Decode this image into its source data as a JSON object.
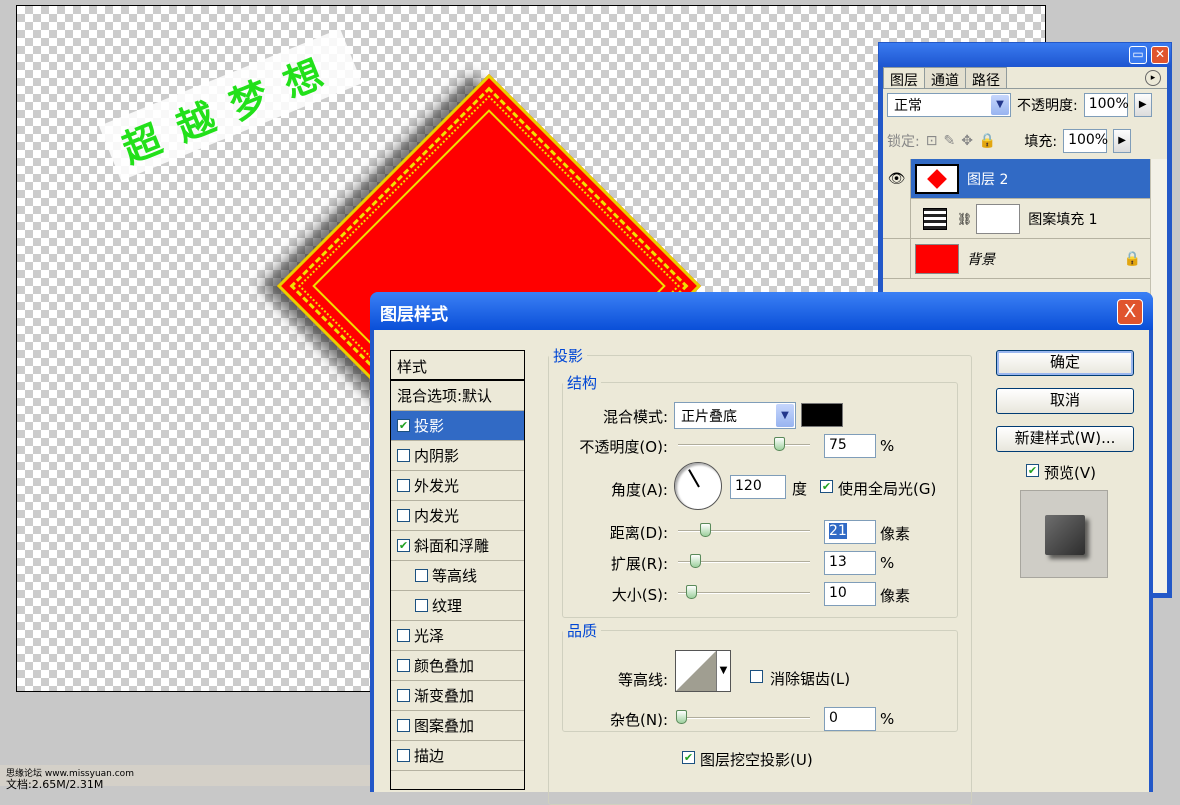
{
  "canvas": {
    "wordart": "超越梦想"
  },
  "status": {
    "watermark": "思缘论坛  www.missyuan.com",
    "docsize": "文档:2.65M/2.31M"
  },
  "layers_panel": {
    "tabs": [
      "图层",
      "通道",
      "路径"
    ],
    "blend_mode": "正常",
    "opacity_label": "不透明度:",
    "opacity_value": "100%",
    "lock_label": "锁定:",
    "fill_label": "填充:",
    "fill_value": "100%",
    "layers": [
      {
        "name": "图层 2",
        "visible": true,
        "selected": true
      },
      {
        "name": "图案填充 1",
        "visible": false,
        "selected": false
      },
      {
        "name": "背景",
        "visible": false,
        "selected": false,
        "locked": true
      }
    ]
  },
  "dialog": {
    "title": "图层样式",
    "close": "X",
    "styles_header": "样式",
    "style_items": [
      {
        "label": "混合选项:默认",
        "checkbox": false
      },
      {
        "label": "投影",
        "checkbox": true,
        "checked": true,
        "selected": true
      },
      {
        "label": "内阴影",
        "checkbox": true,
        "checked": false
      },
      {
        "label": "外发光",
        "checkbox": true,
        "checked": false
      },
      {
        "label": "内发光",
        "checkbox": true,
        "checked": false
      },
      {
        "label": "斜面和浮雕",
        "checkbox": true,
        "checked": true
      },
      {
        "label": "等高线",
        "checkbox": true,
        "checked": false,
        "indent": true
      },
      {
        "label": "纹理",
        "checkbox": true,
        "checked": false,
        "indent": true
      },
      {
        "label": "光泽",
        "checkbox": true,
        "checked": false
      },
      {
        "label": "颜色叠加",
        "checkbox": true,
        "checked": false
      },
      {
        "label": "渐变叠加",
        "checkbox": true,
        "checked": false
      },
      {
        "label": "图案叠加",
        "checkbox": true,
        "checked": false
      },
      {
        "label": "描边",
        "checkbox": true,
        "checked": false
      }
    ],
    "section_title": "投影",
    "structure": {
      "legend": "结构",
      "blend_mode_label": "混合模式:",
      "blend_mode_value": "正片叠底",
      "shadow_color": "#000000",
      "opacity_label": "不透明度(O):",
      "opacity_value": "75",
      "opacity_unit": "%",
      "angle_label": "角度(A):",
      "angle_value": "120",
      "angle_unit": "度",
      "global_light_label": "使用全局光(G)",
      "global_light_checked": true,
      "distance_label": "距离(D):",
      "distance_value": "21",
      "distance_unit": "像素",
      "spread_label": "扩展(R):",
      "spread_value": "13",
      "spread_unit": "%",
      "size_label": "大小(S):",
      "size_value": "10",
      "size_unit": "像素"
    },
    "quality": {
      "legend": "品质",
      "contour_label": "等高线:",
      "antialias_label": "消除锯齿(L)",
      "antialias_checked": false,
      "noise_label": "杂色(N):",
      "noise_value": "0",
      "noise_unit": "%",
      "knockout_label": "图层挖空投影(U)",
      "knockout_checked": true
    },
    "buttons": {
      "ok": "确定",
      "cancel": "取消",
      "new_style": "新建样式(W)...",
      "preview": "预览(V)",
      "preview_checked": true
    }
  }
}
